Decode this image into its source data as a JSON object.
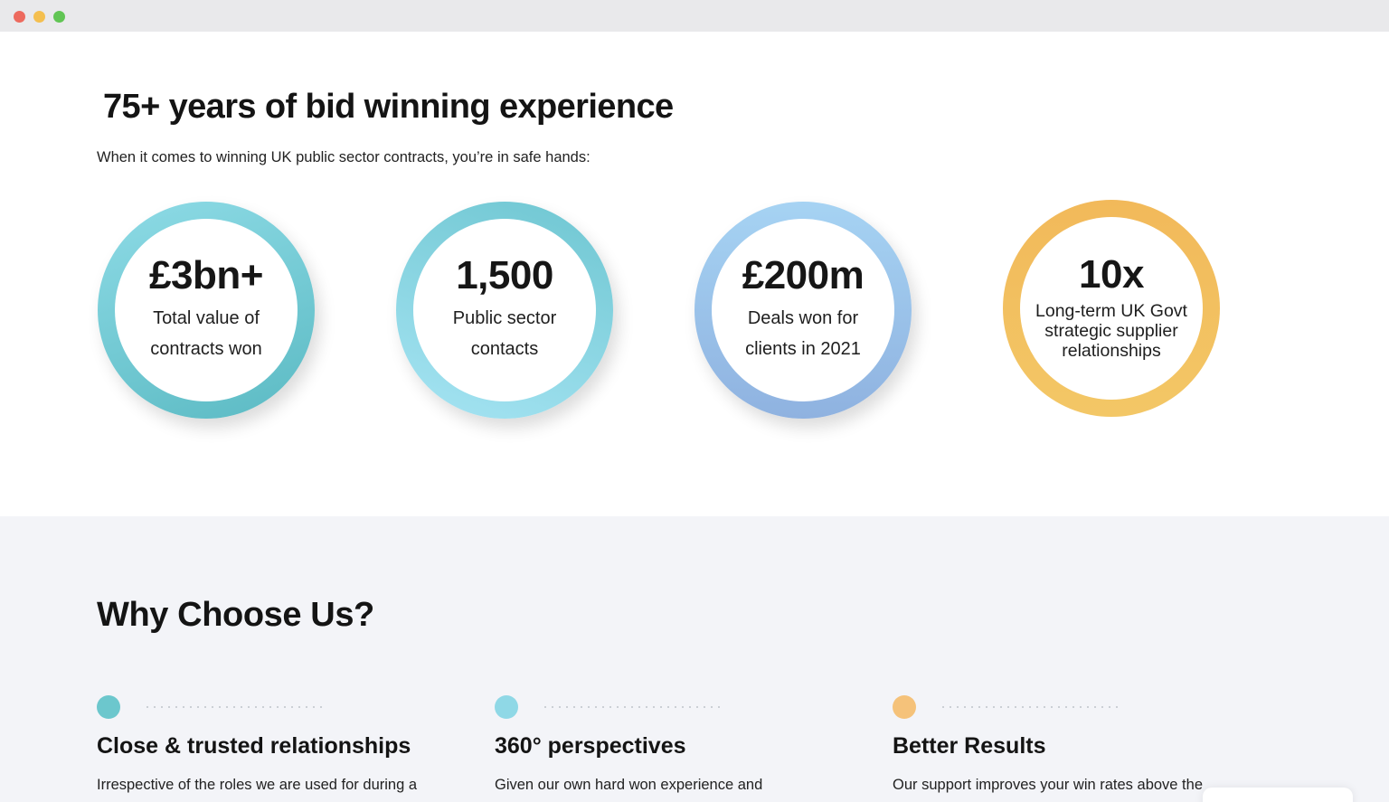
{
  "window": {
    "traffic_lights": [
      {
        "name": "close",
        "color": "#ed6a5e"
      },
      {
        "name": "minimize",
        "color": "#f4bf4f"
      },
      {
        "name": "maximize",
        "color": "#61c554"
      }
    ]
  },
  "hero": {
    "title": "75+ years of bid winning experience",
    "subtitle": "When it comes to winning UK public sector contracts, you’re in safe hands:"
  },
  "stats": [
    {
      "value": "£3bn+",
      "label": "Total value of contracts won",
      "ring_color": "#6cc7d0"
    },
    {
      "value": "1,500",
      "label": "Public sector contacts",
      "ring_color": "#8fd6e8"
    },
    {
      "value": "£200m",
      "label": "Deals won for clients in 2021",
      "ring_color": "#9cc4ec"
    },
    {
      "value": "10x",
      "label": "Long-term UK Govt strategic supplier relationships",
      "ring_color": "#f2be5e"
    }
  ],
  "why": {
    "title": "Why Choose Us?",
    "features": [
      {
        "title": "Close & trusted relationships",
        "text": "Irrespective of the roles we are used for during a",
        "bullet_color": "#6cc7cd"
      },
      {
        "title": "360° perspectives",
        "text": "Given our own hard won experience and",
        "bullet_color": "#8fd8e6"
      },
      {
        "title": "Better Results",
        "text": "Our support improves your win rates above the",
        "bullet_color": "#f5c27a"
      }
    ]
  }
}
